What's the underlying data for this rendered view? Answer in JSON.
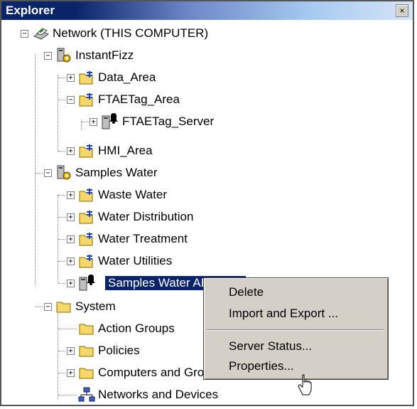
{
  "window": {
    "title": "Explorer",
    "close_glyph": "×"
  },
  "tree": {
    "network_label": "Network (THIS COMPUTER)",
    "instantfizz_label": "InstantFizz",
    "data_area_label": "Data_Area",
    "ftaetag_area_label": "FTAETag_Area",
    "ftaetag_server_label": "FTAETag_Server",
    "hmi_area_label": "HMI_Area",
    "samples_water_label": "Samples Water",
    "waste_water_label": "Waste Water",
    "water_distribution_label": "Water Distribution",
    "water_treatment_label": "Water Treatment",
    "water_utilities_label": "Water Utilities",
    "samples_water_ae_label": "Samples Water AE Alarm",
    "system_label": "System",
    "action_groups_label": "Action Groups",
    "policies_label": "Policies",
    "computers_label": "Computers and Groups",
    "networks_label": "Networks and Devices"
  },
  "context_menu": {
    "delete": "Delete",
    "import_export": "Import and Export ...",
    "server_status": "Server Status...",
    "properties": "Properties..."
  },
  "glyphs": {
    "plus": "+",
    "minus": "−"
  },
  "colors": {
    "selection": "#0a246a",
    "menu_bg": "#d4d0c8",
    "title_start": "#0a246a"
  }
}
